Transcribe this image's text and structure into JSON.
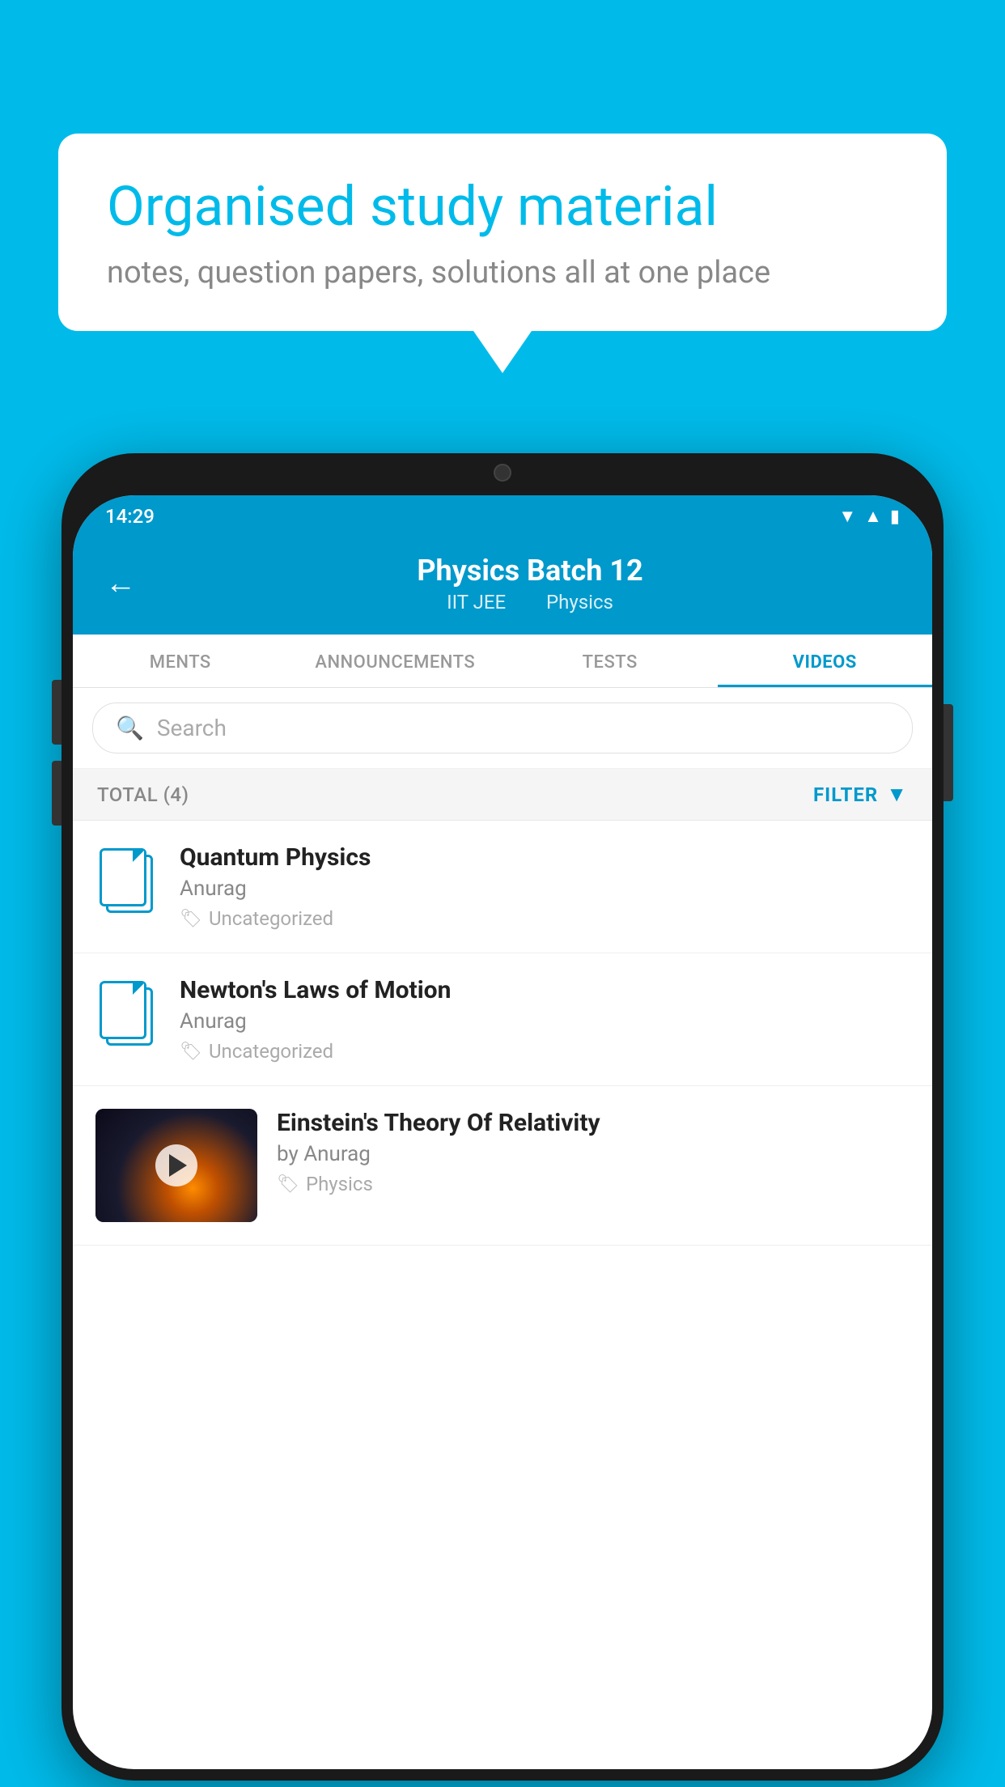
{
  "background": {
    "color": "#00BBEA"
  },
  "speech_bubble": {
    "title": "Organised study material",
    "subtitle": "notes, question papers, solutions all at one place"
  },
  "phone": {
    "status_bar": {
      "time": "14:29"
    },
    "header": {
      "back_label": "←",
      "title": "Physics Batch 12",
      "subtitle_part1": "IIT JEE",
      "subtitle_part2": "Physics"
    },
    "tabs": [
      {
        "label": "MENTS",
        "active": false
      },
      {
        "label": "ANNOUNCEMENTS",
        "active": false
      },
      {
        "label": "TESTS",
        "active": false
      },
      {
        "label": "VIDEOS",
        "active": true
      }
    ],
    "search": {
      "placeholder": "Search"
    },
    "filter_bar": {
      "total_label": "TOTAL (4)",
      "filter_label": "FILTER"
    },
    "videos": [
      {
        "id": 1,
        "title": "Quantum Physics",
        "author": "Anurag",
        "tag": "Uncategorized",
        "has_thumbnail": false
      },
      {
        "id": 2,
        "title": "Newton's Laws of Motion",
        "author": "Anurag",
        "tag": "Uncategorized",
        "has_thumbnail": false
      },
      {
        "id": 3,
        "title": "Einstein's Theory Of Relativity",
        "author": "by Anurag",
        "tag": "Physics",
        "has_thumbnail": true
      }
    ]
  }
}
